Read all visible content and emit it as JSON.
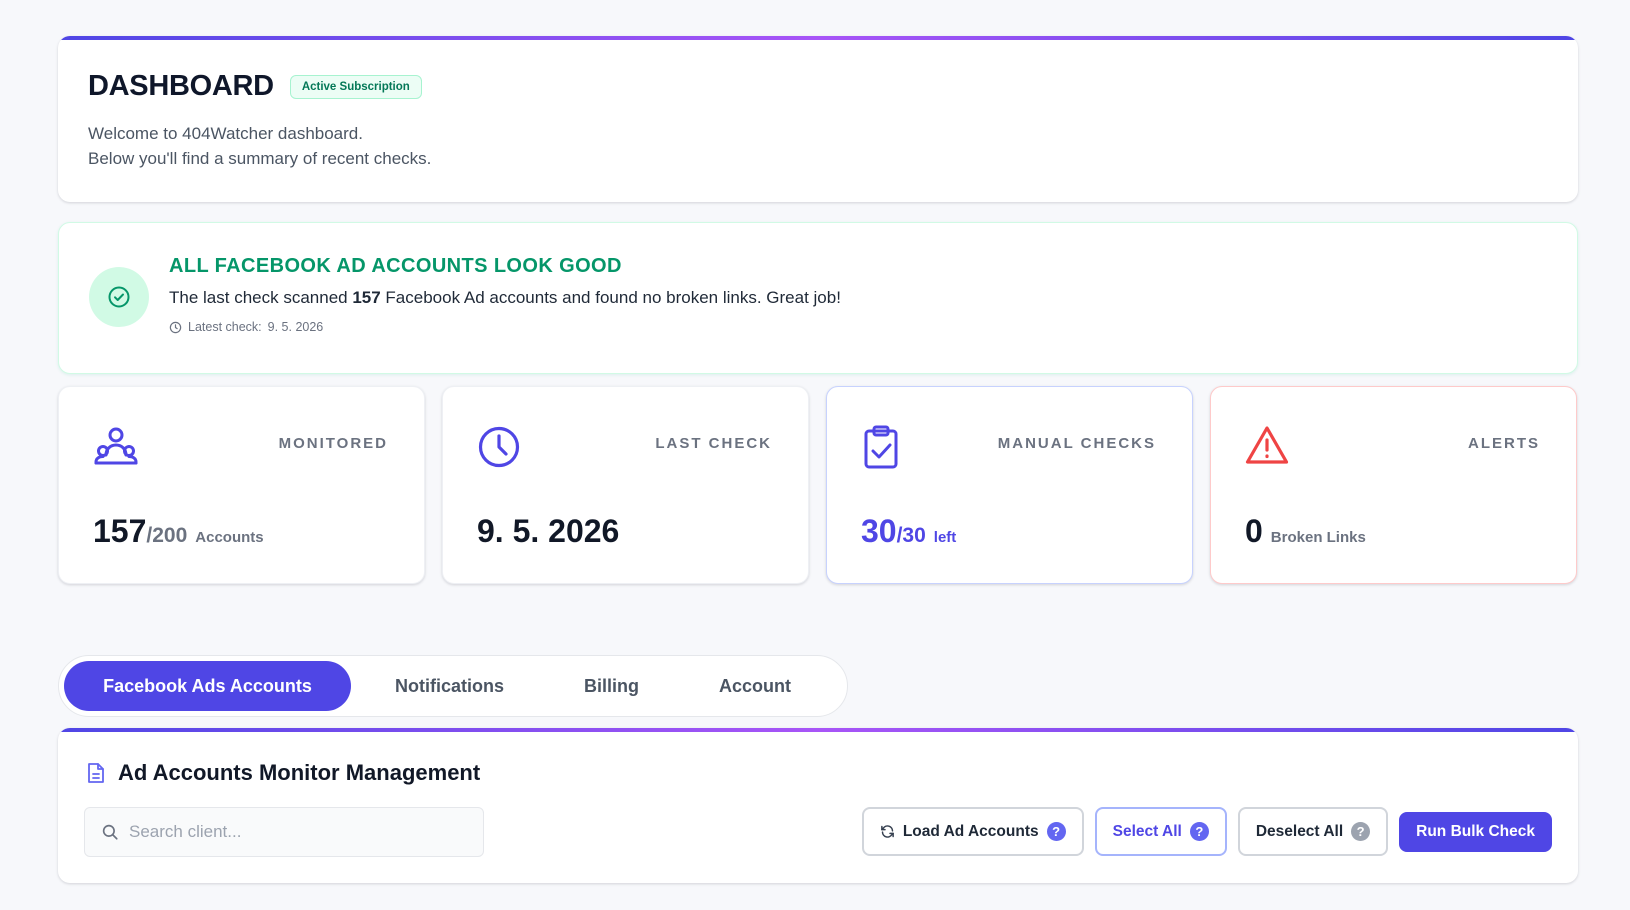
{
  "header": {
    "title": "DASHBOARD",
    "badge": "Active Subscription",
    "welcome_line1": "Welcome to 404Watcher dashboard.",
    "welcome_line2": "Below you'll find a summary of recent checks."
  },
  "status": {
    "title": "ALL FACEBOOK AD ACCOUNTS LOOK GOOD",
    "text_before": "The last check scanned ",
    "scanned_count": "157",
    "text_after": " Facebook Ad accounts and found no broken links. Great job!",
    "latest_check_label": "Latest check:",
    "latest_check_date": "9. 5. 2026"
  },
  "stats": {
    "monitored": {
      "label": "MONITORED",
      "value": "157",
      "denominator": "/200",
      "unit": "Accounts",
      "icon": "users-icon"
    },
    "last_check": {
      "label": "LAST CHECK",
      "value": "9. 5. 2026",
      "icon": "clock-icon"
    },
    "manual_checks": {
      "label": "MANUAL CHECKS",
      "value": "30",
      "denominator": "/30",
      "unit": "left",
      "icon": "clipboard-check-icon"
    },
    "alerts": {
      "label": "ALERTS",
      "value": "0",
      "unit": "Broken Links",
      "icon": "warning-icon"
    }
  },
  "tabs": [
    {
      "label": "Facebook Ads Accounts",
      "active": true
    },
    {
      "label": "Notifications",
      "active": false
    },
    {
      "label": "Billing",
      "active": false
    },
    {
      "label": "Account",
      "active": false
    }
  ],
  "management": {
    "title": "Ad Accounts Monitor Management",
    "search_placeholder": "Search client...",
    "load_label": "Load Ad Accounts",
    "select_all_label": "Select All",
    "deselect_all_label": "Deselect All",
    "run_bulk_label": "Run Bulk Check",
    "help_glyph": "?"
  },
  "colors": {
    "accent": "#4f46e5",
    "success": "#059669",
    "danger": "#ef4444",
    "muted": "#6b7280"
  }
}
